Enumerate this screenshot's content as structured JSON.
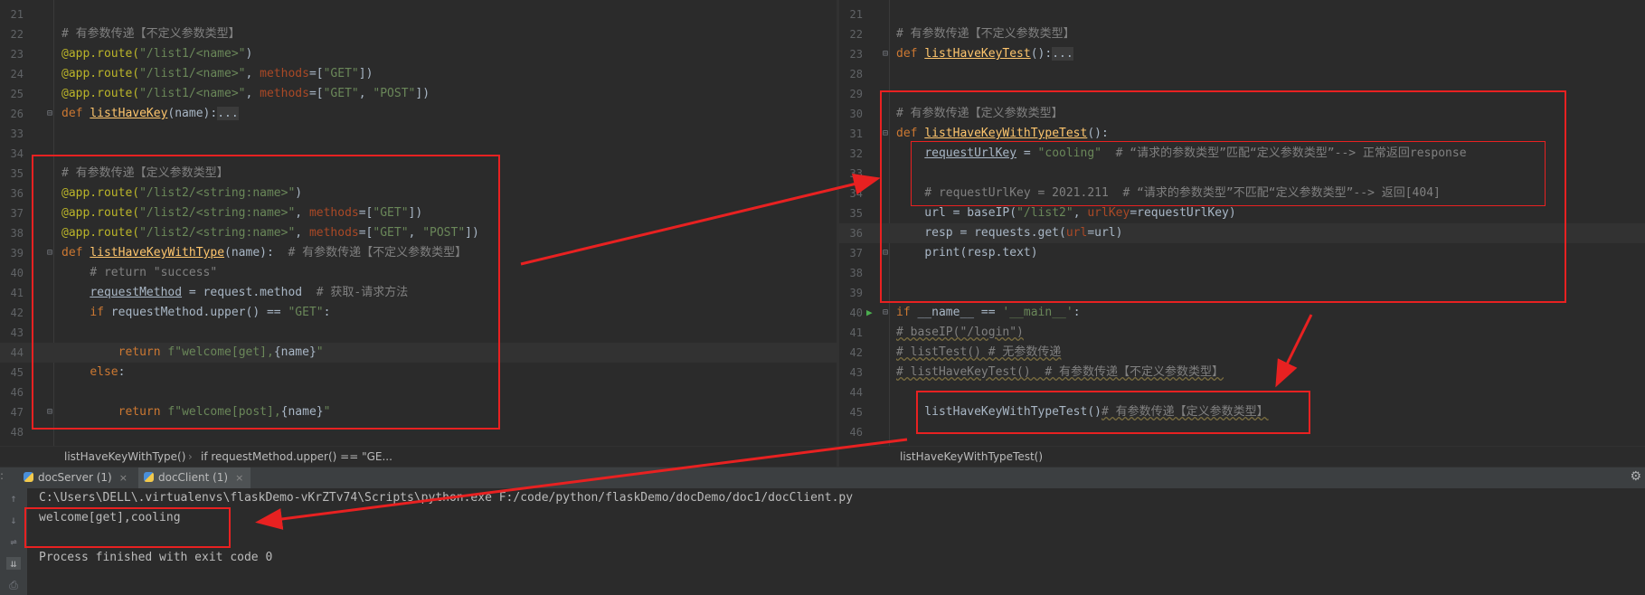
{
  "left_editor": {
    "lines": [
      {
        "num": "21",
        "tokens": []
      },
      {
        "num": "22",
        "tokens": [
          {
            "t": "# 有参数传递【不定义参数类型】",
            "c": "com"
          }
        ]
      },
      {
        "num": "23",
        "tokens": [
          {
            "t": "@app.route(",
            "c": "dec"
          },
          {
            "t": "\"/list1/<name>\"",
            "c": "str"
          },
          {
            "t": ")",
            "c": "plain"
          }
        ]
      },
      {
        "num": "24",
        "tokens": [
          {
            "t": "@app.route(",
            "c": "dec"
          },
          {
            "t": "\"/list1/<name>\"",
            "c": "str"
          },
          {
            "t": ", ",
            "c": "plain"
          },
          {
            "t": "methods",
            "c": "kwa"
          },
          {
            "t": "=[",
            "c": "plain"
          },
          {
            "t": "\"GET\"",
            "c": "str"
          },
          {
            "t": "])",
            "c": "plain"
          }
        ]
      },
      {
        "num": "25",
        "tokens": [
          {
            "t": "@app.route(",
            "c": "dec"
          },
          {
            "t": "\"/list1/<name>\"",
            "c": "str"
          },
          {
            "t": ", ",
            "c": "plain"
          },
          {
            "t": "methods",
            "c": "kwa"
          },
          {
            "t": "=[",
            "c": "plain"
          },
          {
            "t": "\"GET\"",
            "c": "str"
          },
          {
            "t": ", ",
            "c": "plain"
          },
          {
            "t": "\"POST\"",
            "c": "str"
          },
          {
            "t": "])",
            "c": "plain"
          }
        ]
      },
      {
        "num": "26",
        "fold": true,
        "tokens": [
          {
            "t": "def ",
            "c": "kw"
          },
          {
            "t": "listHaveKey",
            "c": "fn"
          },
          {
            "t": "(name):",
            "c": "plain"
          },
          {
            "t": "...",
            "c": "fold"
          }
        ]
      },
      {
        "num": "33",
        "tokens": []
      },
      {
        "num": "34",
        "tokens": []
      },
      {
        "num": "35",
        "tokens": [
          {
            "t": "# 有参数传递【定义参数类型】",
            "c": "com"
          }
        ]
      },
      {
        "num": "36",
        "tokens": [
          {
            "t": "@app.route(",
            "c": "dec"
          },
          {
            "t": "\"/list2/<string:name>\"",
            "c": "str"
          },
          {
            "t": ")",
            "c": "plain"
          }
        ]
      },
      {
        "num": "37",
        "tokens": [
          {
            "t": "@app.route(",
            "c": "dec"
          },
          {
            "t": "\"/list2/<string:name>\"",
            "c": "str"
          },
          {
            "t": ", ",
            "c": "plain"
          },
          {
            "t": "methods",
            "c": "kwa"
          },
          {
            "t": "=[",
            "c": "plain"
          },
          {
            "t": "\"GET\"",
            "c": "str"
          },
          {
            "t": "])",
            "c": "plain"
          }
        ]
      },
      {
        "num": "38",
        "tokens": [
          {
            "t": "@app.route(",
            "c": "dec"
          },
          {
            "t": "\"/list2/<string:name>\"",
            "c": "str"
          },
          {
            "t": ", ",
            "c": "plain"
          },
          {
            "t": "methods",
            "c": "kwa"
          },
          {
            "t": "=[",
            "c": "plain"
          },
          {
            "t": "\"GET\"",
            "c": "str"
          },
          {
            "t": ", ",
            "c": "plain"
          },
          {
            "t": "\"POST\"",
            "c": "str"
          },
          {
            "t": "])",
            "c": "plain"
          }
        ]
      },
      {
        "num": "39",
        "fold": true,
        "tokens": [
          {
            "t": "def ",
            "c": "kw"
          },
          {
            "t": "listHaveKeyWithType",
            "c": "fn"
          },
          {
            "t": "(name):  ",
            "c": "plain"
          },
          {
            "t": "# 有参数传递【不定义参数类型】",
            "c": "com"
          }
        ]
      },
      {
        "num": "40",
        "tokens": [
          {
            "t": "    # return \"success\"",
            "c": "com"
          }
        ]
      },
      {
        "num": "41",
        "tokens": [
          {
            "t": "    ",
            "c": "plain"
          },
          {
            "t": "requestMethod",
            "c": "und"
          },
          {
            "t": " = request.method  ",
            "c": "plain"
          },
          {
            "t": "# 获取-请求方法",
            "c": "com"
          }
        ]
      },
      {
        "num": "42",
        "tokens": [
          {
            "t": "    ",
            "c": "plain"
          },
          {
            "t": "if ",
            "c": "kw"
          },
          {
            "t": "requestMethod.upper() == ",
            "c": "plain"
          },
          {
            "t": "\"GET\"",
            "c": "str"
          },
          {
            "t": ":",
            "c": "plain"
          }
        ]
      },
      {
        "num": "43",
        "tokens": []
      },
      {
        "num": "44",
        "current": true,
        "tokens": [
          {
            "t": "        ",
            "c": "plain"
          },
          {
            "t": "return ",
            "c": "kw"
          },
          {
            "t": "f\"welcome[get],",
            "c": "str"
          },
          {
            "t": "{name}",
            "c": "plain"
          },
          {
            "t": "\"",
            "c": "str"
          }
        ]
      },
      {
        "num": "45",
        "tokens": [
          {
            "t": "    ",
            "c": "plain"
          },
          {
            "t": "else",
            "c": "kw"
          },
          {
            "t": ":",
            "c": "plain"
          }
        ]
      },
      {
        "num": "46",
        "tokens": []
      },
      {
        "num": "47",
        "fold": true,
        "tokens": [
          {
            "t": "        ",
            "c": "plain"
          },
          {
            "t": "return ",
            "c": "kw"
          },
          {
            "t": "f\"welcome[post],",
            "c": "str"
          },
          {
            "t": "{name}",
            "c": "plain"
          },
          {
            "t": "\"",
            "c": "str"
          }
        ]
      },
      {
        "num": "48",
        "tokens": []
      }
    ]
  },
  "right_editor": {
    "lines": [
      {
        "num": "21",
        "tokens": []
      },
      {
        "num": "22",
        "tokens": [
          {
            "t": "# 有参数传递【不定义参数类型】",
            "c": "com"
          }
        ]
      },
      {
        "num": "23",
        "fold": true,
        "tokens": [
          {
            "t": "def ",
            "c": "kw"
          },
          {
            "t": "listHaveKeyTest",
            "c": "fn"
          },
          {
            "t": "():",
            "c": "plain"
          },
          {
            "t": "...",
            "c": "fold"
          }
        ]
      },
      {
        "num": "28",
        "tokens": []
      },
      {
        "num": "29",
        "tokens": []
      },
      {
        "num": "30",
        "tokens": [
          {
            "t": "# 有参数传递【定义参数类型】",
            "c": "com"
          }
        ]
      },
      {
        "num": "31",
        "fold": true,
        "tokens": [
          {
            "t": "def ",
            "c": "kw"
          },
          {
            "t": "listHaveKeyWithTypeTest",
            "c": "fn"
          },
          {
            "t": "():",
            "c": "plain"
          }
        ]
      },
      {
        "num": "32",
        "tokens": [
          {
            "t": "    ",
            "c": "plain"
          },
          {
            "t": "requestUrlKey",
            "c": "und"
          },
          {
            "t": " = ",
            "c": "plain"
          },
          {
            "t": "\"cooling\"",
            "c": "str"
          },
          {
            "t": "  # “请求的参数类型”匹配“定义参数类型”--> 正常返回response",
            "c": "com"
          }
        ]
      },
      {
        "num": "33",
        "tokens": []
      },
      {
        "num": "34",
        "tokens": [
          {
            "t": "    # requestUrlKey = 2021.211  # “请求的参数类型”不匹配“定义参数类型”--> 返回[404]",
            "c": "com"
          }
        ]
      },
      {
        "num": "35",
        "tokens": [
          {
            "t": "    url = baseIP(",
            "c": "plain"
          },
          {
            "t": "\"/list2\"",
            "c": "str"
          },
          {
            "t": ", ",
            "c": "plain"
          },
          {
            "t": "urlKey",
            "c": "kwa"
          },
          {
            "t": "=requestUrlKey)",
            "c": "plain"
          }
        ]
      },
      {
        "num": "36",
        "current": true,
        "tokens": [
          {
            "t": "    resp = requests.get(",
            "c": "plain"
          },
          {
            "t": "url",
            "c": "kwa"
          },
          {
            "t": "=url)",
            "c": "plain"
          }
        ]
      },
      {
        "num": "37",
        "fold": true,
        "tokens": [
          {
            "t": "    ",
            "c": "plain"
          },
          {
            "t": "print",
            "c": "plain"
          },
          {
            "t": "(resp.text)",
            "c": "plain"
          }
        ]
      },
      {
        "num": "38",
        "tokens": []
      },
      {
        "num": "39",
        "tokens": []
      },
      {
        "num": "40",
        "run": true,
        "fold": true,
        "tokens": [
          {
            "t": "if ",
            "c": "kw"
          },
          {
            "t": "__name__ == ",
            "c": "plain"
          },
          {
            "t": "'__main__'",
            "c": "str"
          },
          {
            "t": ":",
            "c": "plain"
          }
        ]
      },
      {
        "num": "41",
        "tokens": [
          {
            "t": "# baseIP(\"/login\")",
            "c": "comu"
          }
        ]
      },
      {
        "num": "42",
        "tokens": [
          {
            "t": "# listTest() # 无参数传递",
            "c": "comu"
          }
        ]
      },
      {
        "num": "43",
        "tokens": [
          {
            "t": "# listHaveKeyTest()  # 有参数传递【不定义参数类型】",
            "c": "comu"
          }
        ]
      },
      {
        "num": "44",
        "tokens": []
      },
      {
        "num": "45",
        "tokens": [
          {
            "t": "    listHaveKeyWithTypeTest()",
            "c": "plain"
          },
          {
            "t": "# 有参数传递【定义参数类型】",
            "c": "comu"
          }
        ]
      },
      {
        "num": "46",
        "tokens": []
      }
    ]
  },
  "breadcrumbs": {
    "left": [
      "listHaveKeyWithType()",
      "›",
      "if requestMethod.upper() == \"GE..."
    ],
    "right": [
      "listHaveKeyWithTypeTest()"
    ]
  },
  "run_tabs": {
    "colon": ":",
    "tabs": [
      {
        "label": "docServer (1)",
        "close": "×",
        "active": false
      },
      {
        "label": "docClient (1)",
        "close": "×",
        "active": true
      }
    ],
    "settings_icon": "⚙"
  },
  "console": {
    "tools": [
      "↑",
      "↓",
      "⇌",
      "⇊",
      "⎙"
    ],
    "lines": [
      "C:\\Users\\DELL\\.virtualenvs\\flaskDemo-vKrZTv74\\Scripts\\python.exe F:/code/python/flaskDemo/docDemo/doc1/docClient.py",
      "welcome[get],cooling",
      "",
      "Process finished with exit code 0"
    ]
  },
  "annotation_color": "#e82121"
}
